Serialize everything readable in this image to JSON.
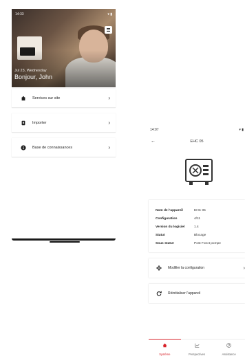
{
  "left_screen": {
    "status_time": "14:33",
    "hero": {
      "date": "Jul 23, Wednesday",
      "greeting": "Bonjour, John"
    },
    "menu_icon": "hamburger-icon",
    "cards": [
      {
        "label": "Services sur site",
        "icon": "home-icon"
      },
      {
        "label": "Importer",
        "icon": "import-icon"
      },
      {
        "label": "Base de connaissances",
        "icon": "info-icon"
      }
    ]
  },
  "right_screen": {
    "status_time": "14:07",
    "title": "EHC 05",
    "device_icon": "appliance-icon",
    "info": [
      {
        "key": "Nom de l'appareil",
        "value": "EHC 05"
      },
      {
        "key": "Configuration",
        "value": "4/11"
      },
      {
        "key": "Version du logiciel",
        "value": "1.4"
      },
      {
        "key": "Statut",
        "value": "Blocage"
      },
      {
        "key": "Sous-statut",
        "value": "Post Fonct pompe"
      }
    ],
    "actions": [
      {
        "label": "Modifier la configuration",
        "icon": "gear-icon"
      },
      {
        "label": "Réinitialiser l'appareil",
        "icon": "refresh-icon"
      }
    ],
    "nav": [
      {
        "label": "Système",
        "icon": "home-icon",
        "active": true
      },
      {
        "label": "Perspectives",
        "icon": "chart-icon",
        "active": false
      },
      {
        "label": "Assistance",
        "icon": "help-icon",
        "active": false
      }
    ],
    "accent_color": "#d8232a"
  }
}
